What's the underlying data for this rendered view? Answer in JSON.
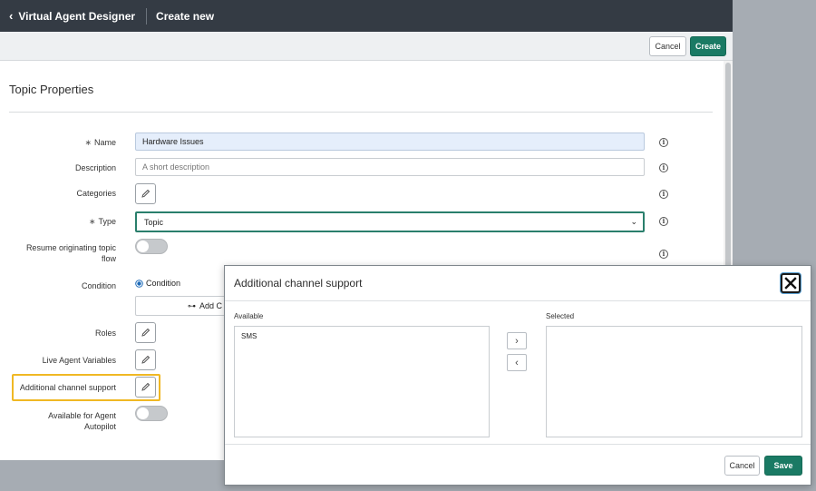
{
  "topbar": {
    "back_icon": "chevron-left-icon",
    "app_title": "Virtual Agent Designer",
    "page_name": "Create new"
  },
  "actionbar": {
    "cancel_label": "Cancel",
    "create_label": "Create"
  },
  "form": {
    "section_title": "Topic Properties",
    "name": {
      "label": "Name",
      "value": "Hardware Issues"
    },
    "description": {
      "label": "Description",
      "placeholder": "A short description"
    },
    "categories": {
      "label": "Categories"
    },
    "type": {
      "label": "Type",
      "value": "Topic"
    },
    "resume": {
      "label_line1": "Resume originating topic",
      "label_line2": "flow"
    },
    "condition": {
      "label": "Condition",
      "radio_label": "Condition",
      "add_label": "Add C"
    },
    "roles": {
      "label": "Roles"
    },
    "live_agent": {
      "label": "Live Agent Variables"
    },
    "channel_support": {
      "label": "Additional channel support"
    },
    "autopilot": {
      "label_line1": "Available for Agent",
      "label_line2": "Autopilot"
    },
    "required_marker": "∗",
    "info_glyph": "i",
    "chevron_glyph": "⌄",
    "add_glyph": "⊶"
  },
  "modal": {
    "title": "Additional channel support",
    "available_label": "Available",
    "selected_label": "Selected",
    "available_items": [
      "SMS"
    ],
    "move_right_glyph": "›",
    "move_left_glyph": "‹",
    "cancel_label": "Cancel",
    "save_label": "Save"
  },
  "colors": {
    "topbar": "#343b44",
    "primary": "#1a7a64",
    "highlight": "#f0b824",
    "filled_field": "#e5eefb"
  }
}
